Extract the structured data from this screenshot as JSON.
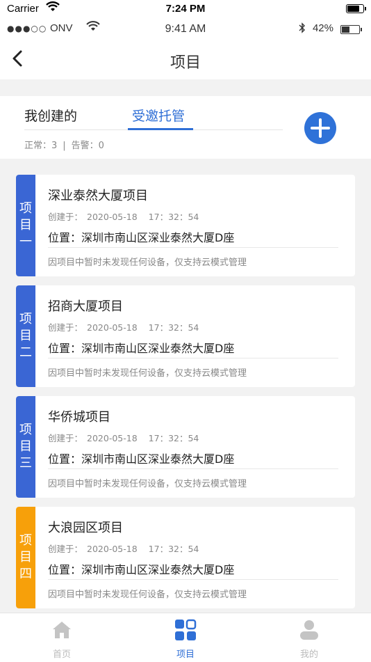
{
  "system_bar": {
    "carrier": "Carrier",
    "time": "7:24 PM"
  },
  "status_bar": {
    "signal_dots": "●●●○○",
    "operator": "ONV",
    "time": "9:41 AM",
    "battery_percent": "42%"
  },
  "nav": {
    "title": "项目",
    "back_icon": "chevron-left-icon"
  },
  "tabs": {
    "mine_label": "我创建的",
    "managed_label": "受邀托管",
    "active": "managed",
    "accent_color": "#2f6fd6"
  },
  "counts": {
    "normal": "正常：3",
    "separator": "|",
    "alarm": "告警：0"
  },
  "projects": [
    {
      "badge": "项目一",
      "badge_color": "#3a66d4",
      "name": "深业泰然大厦项目",
      "created_label": "创建于：",
      "created_date": "2020-05-18",
      "created_time": "17：32：54",
      "location": "位置：深圳市南山区深业泰然大厦D座",
      "note": "因项目中暂时未发现任何设备，仅支持云模式管理"
    },
    {
      "badge": "项目二",
      "badge_color": "#3a66d4",
      "name": "招商大厦项目",
      "created_label": "创建于：",
      "created_date": "2020-05-18",
      "created_time": "17：32：54",
      "location": "位置：深圳市南山区深业泰然大厦D座",
      "note": "因项目中暂时未发现任何设备，仅支持云模式管理"
    },
    {
      "badge": "项目三",
      "badge_color": "#3a66d4",
      "name": "华侨城项目",
      "created_label": "创建于：",
      "created_date": "2020-05-18",
      "created_time": "17：32：54",
      "location": "位置：深圳市南山区深业泰然大厦D座",
      "note": "因项目中暂时未发现任何设备，仅支持云模式管理"
    },
    {
      "badge": "项目四",
      "badge_color": "#f7a00a",
      "name": "大浪园区项目",
      "created_label": "创建于：",
      "created_date": "2020-05-18",
      "created_time": "17：32：54",
      "location": "位置：深圳市南山区深业泰然大厦D座",
      "note": "因项目中暂时未发现任何设备，仅支持云模式管理"
    }
  ],
  "tab_bar": {
    "items": [
      {
        "label": "首页",
        "icon": "home-icon",
        "active": false
      },
      {
        "label": "项目",
        "icon": "grid-icon",
        "active": true
      },
      {
        "label": "我的",
        "icon": "user-icon",
        "active": false
      }
    ],
    "active_color": "#2f6fd6",
    "inactive_color": "#bbbbbb"
  }
}
